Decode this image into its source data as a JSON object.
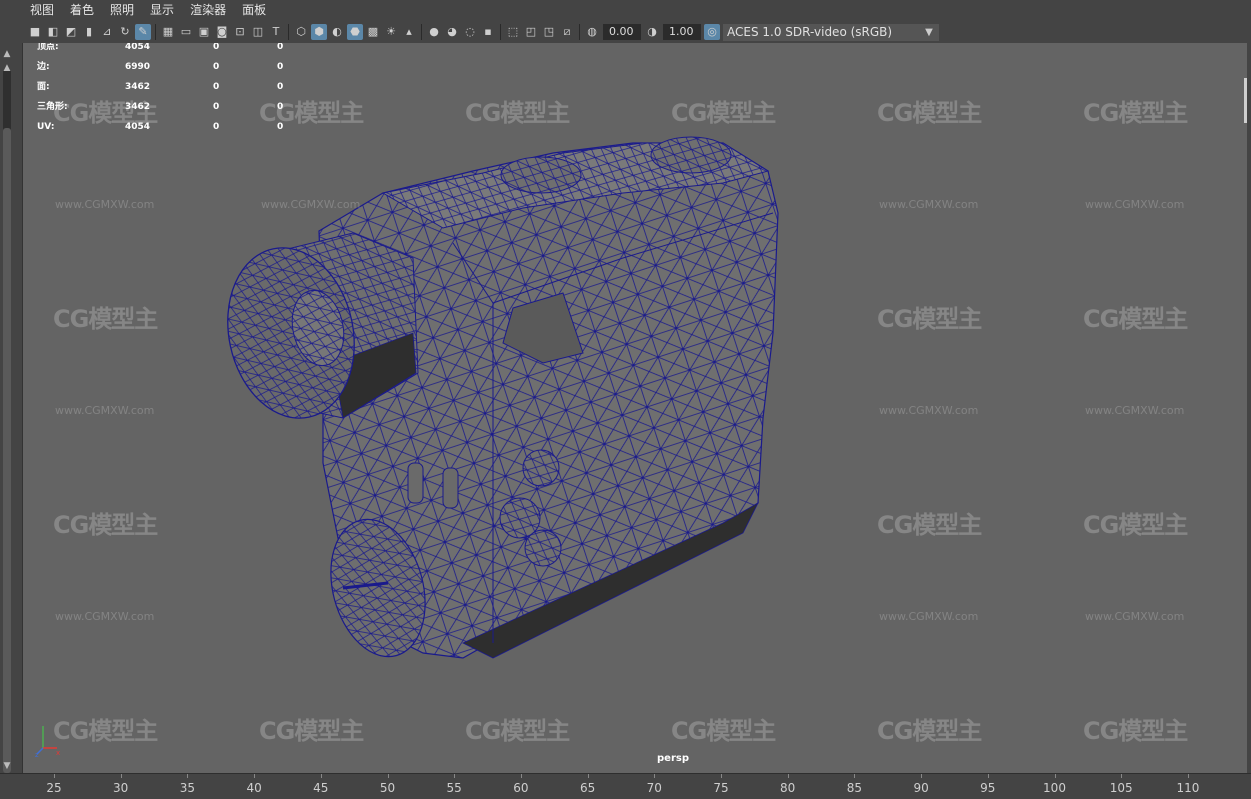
{
  "menu": [
    "视图",
    "着色",
    "照明",
    "显示",
    "渲染器",
    "面板"
  ],
  "toolbar": {
    "exposure_value": "0.00",
    "gamma_value": "1.00",
    "color_space": "ACES 1.0 SDR-video (sRGB)"
  },
  "stats": [
    {
      "label": "顶点:",
      "value": "4054",
      "a": "0",
      "b": "0"
    },
    {
      "label": "边:",
      "value": "6990",
      "a": "0",
      "b": "0"
    },
    {
      "label": "面:",
      "value": "3462",
      "a": "0",
      "b": "0"
    },
    {
      "label": "三角形:",
      "value": "3462",
      "a": "0",
      "b": "0"
    },
    {
      "label": "UV:",
      "value": "4054",
      "a": "0",
      "b": "0"
    }
  ],
  "camera_label": "persp",
  "watermark": {
    "logo": "CG模型主",
    "url": "www.CGMXW.com"
  },
  "timeline_ticks": [
    "25",
    "30",
    "35",
    "40",
    "45",
    "50",
    "55",
    "60",
    "65",
    "70",
    "75",
    "80",
    "85",
    "90",
    "95",
    "100",
    "105",
    "110"
  ],
  "colors": {
    "wireframe": "#1a1a8c",
    "viewport_bg": "#646464",
    "model_fill": "#6f6f6f",
    "model_dark": "#3a3a3a"
  }
}
